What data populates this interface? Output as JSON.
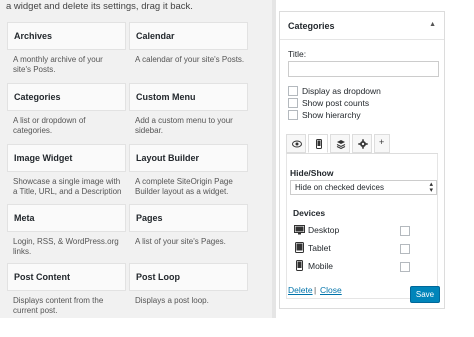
{
  "intro_text": "a widget and delete its settings, drag it back.",
  "widgets": [
    {
      "title": "Archives",
      "desc1": "A monthly archive of your",
      "desc2": "site's Posts."
    },
    {
      "title": "Calendar",
      "desc1": "A calendar of your site's Posts.",
      "desc2": ""
    },
    {
      "title": "Categories",
      "desc1": "A list or dropdown of",
      "desc2": "categories."
    },
    {
      "title": "Custom Menu",
      "desc1": "Add a custom menu to your",
      "desc2": "sidebar."
    },
    {
      "title": "Image Widget",
      "desc1": "Showcase a single image with",
      "desc2": "a Title, URL, and a Description"
    },
    {
      "title": "Layout Builder",
      "desc1": "A complete SiteOrigin Page",
      "desc2": "Builder layout as a widget."
    },
    {
      "title": "Meta",
      "desc1": "Login, RSS, & WordPress.org",
      "desc2": "links."
    },
    {
      "title": "Pages",
      "desc1": "A list of your site's Pages.",
      "desc2": ""
    },
    {
      "title": "Post Content",
      "desc1": "Displays content from the",
      "desc2": "current post."
    },
    {
      "title": "Post Loop",
      "desc1": "Displays a post loop.",
      "desc2": ""
    }
  ],
  "panel": {
    "title": "Categories",
    "collapse_glyph": "▲",
    "title_label": "Title:",
    "title_value": "",
    "options": [
      "Display as dropdown",
      "Show post counts",
      "Show hierarchy"
    ],
    "tabs": [
      {
        "icon": "eye-icon",
        "active": false
      },
      {
        "icon": "mobile-icon",
        "active": true
      },
      {
        "icon": "stack-icon",
        "active": false
      },
      {
        "icon": "gear-icon",
        "active": false
      },
      {
        "icon": "plus-icon",
        "glyph": "+",
        "active": false
      }
    ],
    "hide_show_label": "Hide/Show",
    "hide_show_value": "Hide on checked devices",
    "devices_label": "Devices",
    "devices": [
      {
        "label": "Desktop",
        "icon": "desktop-icon"
      },
      {
        "label": "Tablet",
        "icon": "tablet-icon"
      },
      {
        "label": "Mobile",
        "icon": "mobile-icon"
      }
    ],
    "delete_label": "Delete",
    "separator": "|",
    "close_label": "Close",
    "save_label": "Save"
  },
  "colors": {
    "accent": "#0085ba",
    "link": "#0073aa",
    "background": "#f1f1f1"
  }
}
